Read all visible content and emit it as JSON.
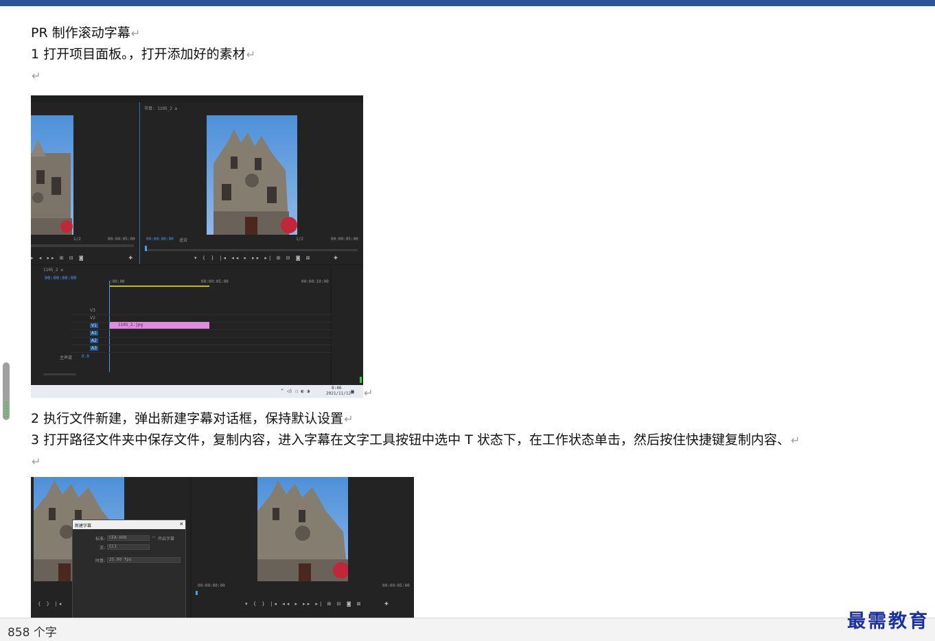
{
  "document": {
    "title_line": "PR 制作滚动字幕",
    "step1": "1 打开项目面板。，打开添加好的素材",
    "step2": "2 执行文件新建，弹出新建字幕对话框，保持默认设置",
    "step3": "3 打开路径文件夹中保存文件，复制内容，进入字幕在文字工具按钮中选中 T 状态下，在工作状态单击，然后按住快捷键复制内容、",
    "paragraph_mark": "↵"
  },
  "screenshot1": {
    "source_monitor_header": "节目: 1105_2 ≡",
    "source_timecode": "00:00:05:00",
    "source_fit": "1/2",
    "program_timecode_left": "00:00:00:00",
    "program_fit": "适合",
    "program_scale": "1/2",
    "program_timecode_right": "00:00:05:00",
    "timeline_name": "1105_2 ≡",
    "timeline_timecode": "00:00:00:00",
    "ruler_marks": [
      ":00:00",
      "00:00:05:00",
      "00:00:10:00"
    ],
    "tracks": [
      "V3",
      "V2",
      "V1",
      "A1",
      "A2",
      "A3"
    ],
    "master_label": "主声道",
    "master_value": "0.0",
    "clip_label": "1105_2.jpg",
    "taskbar_time": "8:46",
    "taskbar_date": "2021/11/12"
  },
  "screenshot2": {
    "dialog_title": "新建字幕",
    "field_standard_label": "标准:",
    "field_standard_value": "CEA-608",
    "field_stream_label": "流:",
    "field_stream_value": "CC1",
    "field_timebase_label": "时基:",
    "field_timebase_value": "25.00 fps",
    "checkbox_label": "开启字幕",
    "program_timecode_left": "00:00:00:00",
    "program_timecode_right": "00:00:05:00"
  },
  "status": {
    "word_count": "858 个字"
  },
  "watermark": "最需教育",
  "colors": {
    "ribbon_accent": "#2b579a",
    "clip_pink": "#e28ae0",
    "timecode_blue": "#4a9df0",
    "watermark_blue": "#1a2fa0"
  }
}
